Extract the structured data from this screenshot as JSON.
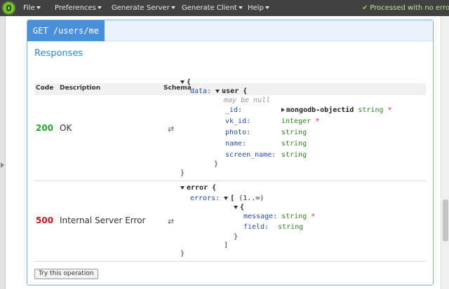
{
  "menu": {
    "file": "File",
    "preferences": "Preferences",
    "generate_server": "Generate Server",
    "generate_client": "Generate Client",
    "help": "Help",
    "status": "Processed with no error"
  },
  "operation": {
    "method_path": "GET /users/me"
  },
  "responses": {
    "title": "Responses",
    "columns": {
      "code": "Code",
      "description": "Description",
      "schema": "Schema"
    },
    "rows": [
      {
        "code": "200",
        "description": "OK",
        "schema": {
          "open_brace": "{",
          "data_key": "data:",
          "user_label": "user {",
          "nullable": "may be null",
          "fields": [
            {
              "name": "_id:",
              "ref": "mongodb-objectid",
              "type": "string",
              "required": "*"
            },
            {
              "name": "vk_id:",
              "type": "integer",
              "required": "*"
            },
            {
              "name": "photo:",
              "type": "string"
            },
            {
              "name": "name:",
              "type": "string"
            },
            {
              "name": "screen_name:",
              "type": "string"
            }
          ],
          "close_inner": "}",
          "close_outer": "}"
        }
      },
      {
        "code": "500",
        "description": "Internal Server Error",
        "schema": {
          "error_label": "error {",
          "errors_key": "errors:",
          "array_open": "[",
          "range": "(1..∞)",
          "item_open": "{",
          "fields": [
            {
              "name": "message:",
              "type": "string",
              "required": "*"
            },
            {
              "name": "field:",
              "type": "string"
            }
          ],
          "item_close": "}",
          "array_close": "]",
          "close_outer": "}"
        }
      }
    ],
    "swap_glyph": "⇄"
  },
  "try_button": "Try this operation",
  "colors": {
    "topbar": "#414141",
    "accent": "#4a90d9",
    "title": "#2a8ad4",
    "code_200": "#2aa12a",
    "code_500": "#d0121b",
    "type": "#2e8b1d",
    "key": "#2a4db0",
    "required": "#e0252c"
  }
}
